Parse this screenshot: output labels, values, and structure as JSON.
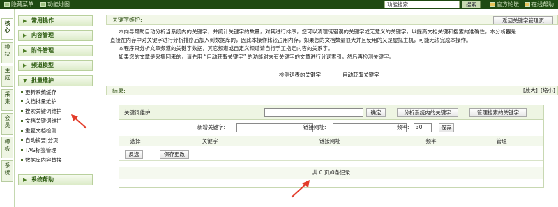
{
  "topbar": {
    "hide_menu": "隐藏菜单",
    "site_map": "功能地图",
    "search_value": "功能搜索",
    "search_button": "搜索",
    "forum": "官方论坛",
    "help": "在线帮助"
  },
  "vtabs": [
    "核心",
    "模块",
    "生成",
    "采集",
    "会员",
    "模板",
    "系统"
  ],
  "sidebar": {
    "sections": [
      "常用操作",
      "内容管理",
      "附件管理",
      "频道模型",
      "批量维护",
      "系统帮助"
    ],
    "items": [
      "更新系统缓存",
      "文档批量维护",
      "搜索关键词维护",
      "文档关键词维护",
      "重复文档检测",
      "自动摘要|分页",
      "TAG标签管理",
      "数据库内容替换"
    ]
  },
  "main": {
    "title": "关键字维护:",
    "return_button": "返回关键字管理页",
    "desc_lines": [
      "本向导帮助自动分析当系统内的关键字，并统计关键字的数量，对其进行排序，您可以清理链错误的关键字或无意义的关键字，以提高文档关键和搜索的准确性，本分析器是",
      "直接在内存中对关键字进行分析排序后加入到数据库的，因此本操作比较占用内存，如果您的文档数量很大并且使用的又是虚拟主机，可能无法完成本操作。",
      "本程序只分析文章频道的关键字数据，其它频道或自定义频道请自行手工指定内容的关系字。",
      "如果您的文章是采集回来的，请先用 “自动获取关键字” 的功能对未有关键字的文章进行分词索引，然后再检测关键字。"
    ],
    "link_detect": "检测词表的关键字",
    "link_auto": "自动获取关键字",
    "result_label": "结果:",
    "enlarge": "[放大]",
    "shrink": "[缩小]"
  },
  "keyword_panel": {
    "title": "关键词维护",
    "confirm_button": "确定",
    "analyze_button": "分析系统内的关键字",
    "manage_button": "管理搜索的关键字",
    "new_keyword_label": "新增关键字:",
    "link_label": "链接网址:",
    "freq_label": "频率:",
    "freq_value": "30",
    "save_button": "保存",
    "columns": [
      "选择",
      "关键字",
      "链接网址",
      "频率",
      "管理"
    ],
    "invert_button": "反选",
    "save_changes_button": "保存更改",
    "pager": "共 0 页/0条记录"
  },
  "colors": {
    "topbar": "#1f4a12",
    "accent": "#2b5a0e",
    "arrow": "#e33c2a"
  }
}
